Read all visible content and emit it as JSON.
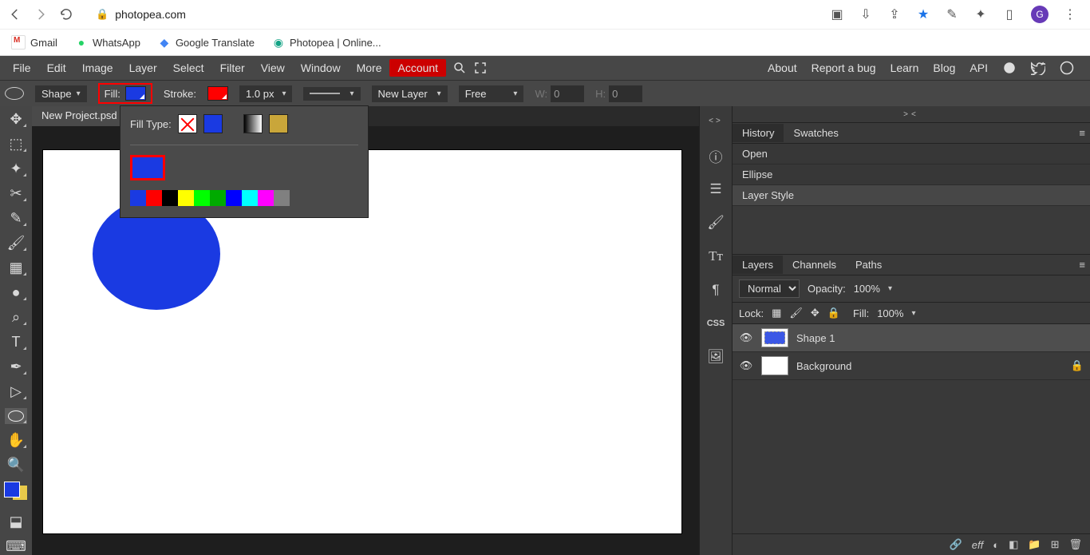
{
  "browser": {
    "url": "photopea.com",
    "avatar_letter": "G",
    "bookmarks": [
      "Gmail",
      "WhatsApp",
      "Google Translate",
      "Photopea | Online..."
    ]
  },
  "menubar": {
    "items": [
      "File",
      "Edit",
      "Image",
      "Layer",
      "Select",
      "Filter",
      "View",
      "Window",
      "More"
    ],
    "account": "Account",
    "right": [
      "About",
      "Report a bug",
      "Learn",
      "Blog",
      "API"
    ]
  },
  "options_bar": {
    "mode": "Shape",
    "fill_label": "Fill:",
    "fill_color": "#1A3AE2",
    "stroke_label": "Stroke:",
    "stroke_color": "#ff0000",
    "stroke_width": "1.0 px",
    "new_layer": "New Layer",
    "constraint": "Free",
    "w_label": "W:",
    "w_value": "0",
    "h_label": "H:",
    "h_value": "0"
  },
  "document": {
    "tab_name": "New Project.psd"
  },
  "fill_popup": {
    "label": "Fill Type:",
    "palette": [
      "#1A3AE2",
      "#ff0000",
      "#000000",
      "#ffff00",
      "#00ff00",
      "#00aa00",
      "#0000ff",
      "#00ffff",
      "#ff00ff",
      "#808080"
    ]
  },
  "history_panel": {
    "tabs": [
      "History",
      "Swatches"
    ],
    "items": [
      "Open",
      "Ellipse",
      "Layer Style"
    ]
  },
  "layers_panel": {
    "tabs": [
      "Layers",
      "Channels",
      "Paths"
    ],
    "blend": "Normal",
    "opacity_label": "Opacity:",
    "opacity": "100%",
    "lock_label": "Lock:",
    "fill_label": "Fill:",
    "fill": "100%",
    "layers": [
      {
        "name": "Shape 1",
        "thumb": "shape",
        "selected": true,
        "locked": false
      },
      {
        "name": "Background",
        "thumb": "white",
        "selected": false,
        "locked": true
      }
    ],
    "footer_eff": "eff"
  }
}
